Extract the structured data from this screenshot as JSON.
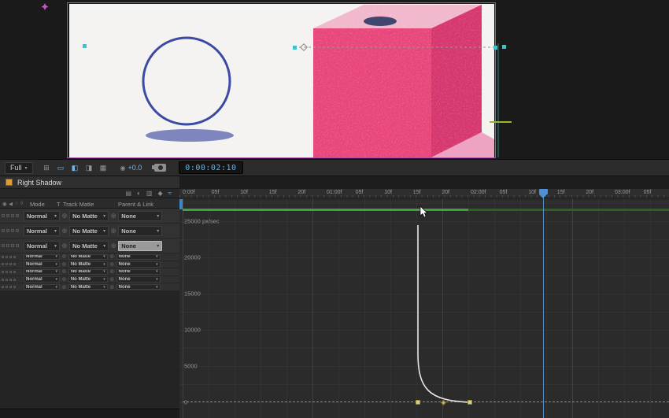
{
  "viewer": {
    "toolbar": {
      "magnification_label": "Full",
      "exposure_value": "+0.0",
      "timecode": "0:00:02:10"
    }
  },
  "left_panel": {
    "comp_tab_label": "Right Shadow",
    "headers": {
      "mode": "Mode",
      "t": "T",
      "track_matte": "Track Matte",
      "parent_link": "Parent & Link"
    },
    "rows": [
      {
        "mode": "Normal",
        "matte": "No Matte",
        "parent": "None",
        "size": "lg",
        "highlight": false
      },
      {
        "mode": "Normal",
        "matte": "No Matte",
        "parent": "None",
        "size": "lg",
        "highlight": false
      },
      {
        "mode": "Normal",
        "matte": "No Matte",
        "parent": "None",
        "size": "lg",
        "highlight": true
      },
      {
        "mode": "Normal",
        "matte": "No Matte",
        "parent": "None",
        "size": "sm",
        "highlight": false
      },
      {
        "mode": "Normal",
        "matte": "No Matte",
        "parent": "None",
        "size": "sm",
        "highlight": false
      },
      {
        "mode": "Normal",
        "matte": "No Matte",
        "parent": "None",
        "size": "sm",
        "highlight": false
      },
      {
        "mode": "Normal",
        "matte": "No Matte",
        "parent": "None",
        "size": "sm",
        "highlight": false
      },
      {
        "mode": "Normal",
        "matte": "No Matte",
        "parent": "None",
        "size": "sm",
        "highlight": false
      }
    ]
  },
  "timeline": {
    "ruler_labels": [
      "0:00f",
      "05f",
      "10f",
      "15f",
      "20f",
      "01:00f",
      "05f",
      "10f",
      "15f",
      "20f",
      "02:00f",
      "05f",
      "10f",
      "15f",
      "20f",
      "03:00f",
      "05f"
    ],
    "y_axis_labels": [
      "25000 px/sec",
      "20000",
      "15000",
      "10000",
      "5000",
      "0"
    ],
    "graph": {
      "unit": "px/sec",
      "y_max": 25000,
      "keyframes_x": [
        531,
        564,
        597
      ]
    },
    "playhead_time": "0:00:02:10"
  },
  "icons": {
    "caret": "▾",
    "pickwhip": "◎",
    "grid_options": "⊞",
    "mask_visibility": "▭",
    "region_of_interest": "◧",
    "channels": "◨",
    "resolution": "▦",
    "exposure": "◉",
    "mini_flowchart": "▤",
    "shy": "◐",
    "frame_blend": "▥",
    "motion_blur": "◆",
    "graph_editor": "≈",
    "eye": "◉",
    "audio": "◀",
    "solo": "○",
    "lock": "◊"
  },
  "colors": {
    "accent_blue": "#4e8fd5",
    "timecode_cyan": "#5cb8e6",
    "work_area_green": "#3fa23a",
    "cube_front_pink": "#e84579",
    "cube_top_pink": "#f2b7cc",
    "cube_side_pink": "#d6356d",
    "circle_blue": "#3b4aa3",
    "shadow_purple": "#7f85bd",
    "selection_magenta": "#a94faa",
    "handle_teal": "#3fc3c6",
    "keyframe_yellow": "#ddd08a"
  }
}
